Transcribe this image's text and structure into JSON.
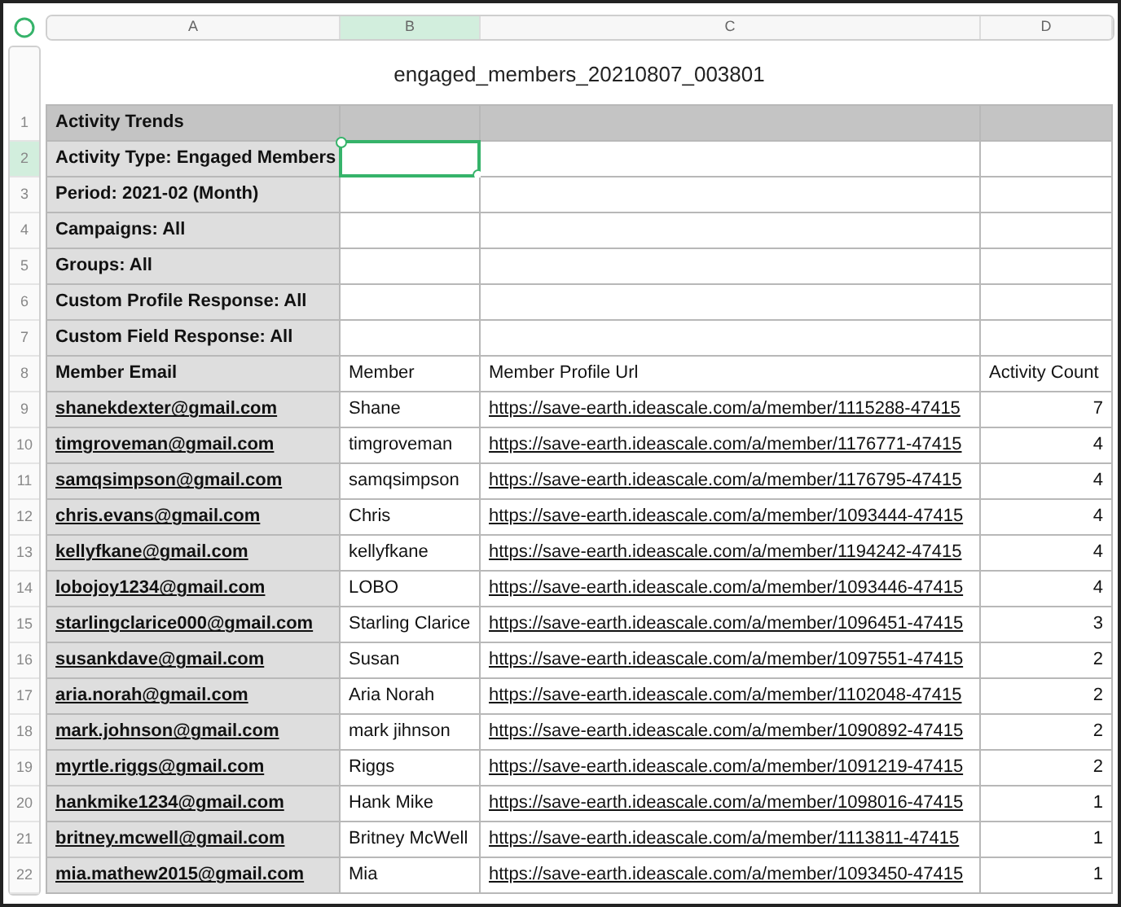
{
  "columns": [
    {
      "label": "A",
      "selected": false
    },
    {
      "label": "B",
      "selected": true
    },
    {
      "label": "C",
      "selected": false
    },
    {
      "label": "D",
      "selected": false
    }
  ],
  "title": "engaged_members_20210807_003801",
  "rows": [
    {
      "number": "1",
      "selected": false,
      "kind": "section",
      "cells": [
        "Activity Trends",
        "",
        "",
        ""
      ]
    },
    {
      "number": "2",
      "selected": true,
      "kind": "meta",
      "cells": [
        "Activity Type: Engaged Members",
        "",
        "",
        ""
      ]
    },
    {
      "number": "3",
      "selected": false,
      "kind": "meta",
      "cells": [
        "Period: 2021-02 (Month)",
        "",
        "",
        ""
      ]
    },
    {
      "number": "4",
      "selected": false,
      "kind": "meta",
      "cells": [
        "Campaigns: All",
        "",
        "",
        ""
      ]
    },
    {
      "number": "5",
      "selected": false,
      "kind": "meta",
      "cells": [
        "Groups: All",
        "",
        "",
        ""
      ]
    },
    {
      "number": "6",
      "selected": false,
      "kind": "meta",
      "cells": [
        "Custom Profile Response: All",
        "",
        "",
        ""
      ]
    },
    {
      "number": "7",
      "selected": false,
      "kind": "meta",
      "cells": [
        "Custom Field Response: All",
        "",
        "",
        ""
      ]
    },
    {
      "number": "8",
      "selected": false,
      "kind": "header",
      "cells": [
        "Member Email",
        "Member",
        "Member Profile Url",
        "Activity Count"
      ]
    },
    {
      "number": "9",
      "selected": false,
      "kind": "data",
      "cells": [
        "shanekdexter@gmail.com",
        "Shane",
        "https://save-earth.ideascale.com/a/member/1115288-47415",
        "7"
      ]
    },
    {
      "number": "10",
      "selected": false,
      "kind": "data",
      "cells": [
        "timgroveman@gmail.com",
        "timgroveman",
        "https://save-earth.ideascale.com/a/member/1176771-47415",
        "4"
      ]
    },
    {
      "number": "11",
      "selected": false,
      "kind": "data",
      "cells": [
        "samqsimpson@gmail.com",
        "samqsimpson",
        "https://save-earth.ideascale.com/a/member/1176795-47415",
        "4"
      ]
    },
    {
      "number": "12",
      "selected": false,
      "kind": "data",
      "cells": [
        "chris.evans@gmail.com",
        "Chris",
        "https://save-earth.ideascale.com/a/member/1093444-47415",
        "4"
      ]
    },
    {
      "number": "13",
      "selected": false,
      "kind": "data",
      "cells": [
        "kellyfkane@gmail.com",
        "kellyfkane",
        "https://save-earth.ideascale.com/a/member/1194242-47415",
        "4"
      ]
    },
    {
      "number": "14",
      "selected": false,
      "kind": "data",
      "cells": [
        "lobojoy1234@gmail.com",
        "LOBO",
        "https://save-earth.ideascale.com/a/member/1093446-47415",
        "4"
      ]
    },
    {
      "number": "15",
      "selected": false,
      "kind": "data",
      "cells": [
        "starlingclarice000@gmail.com",
        "Starling Clarice",
        "https://save-earth.ideascale.com/a/member/1096451-47415",
        "3"
      ]
    },
    {
      "number": "16",
      "selected": false,
      "kind": "data",
      "cells": [
        "susankdave@gmail.com",
        "Susan",
        "https://save-earth.ideascale.com/a/member/1097551-47415",
        "2"
      ]
    },
    {
      "number": "17",
      "selected": false,
      "kind": "data",
      "cells": [
        "aria.norah@gmail.com",
        "Aria Norah",
        "https://save-earth.ideascale.com/a/member/1102048-47415",
        "2"
      ]
    },
    {
      "number": "18",
      "selected": false,
      "kind": "data",
      "cells": [
        "mark.johnson@gmail.com",
        "mark jihnson",
        "https://save-earth.ideascale.com/a/member/1090892-47415",
        "2"
      ]
    },
    {
      "number": "19",
      "selected": false,
      "kind": "data",
      "cells": [
        "myrtle.riggs@gmail.com",
        "Riggs",
        "https://save-earth.ideascale.com/a/member/1091219-47415",
        "2"
      ]
    },
    {
      "number": "20",
      "selected": false,
      "kind": "data",
      "cells": [
        "hankmike1234@gmail.com",
        "Hank Mike",
        "https://save-earth.ideascale.com/a/member/1098016-47415",
        "1"
      ]
    },
    {
      "number": "21",
      "selected": false,
      "kind": "data",
      "cells": [
        "britney.mcwell@gmail.com",
        "Britney McWell",
        "https://save-earth.ideascale.com/a/member/1113811-47415",
        "1"
      ]
    },
    {
      "number": "22",
      "selected": false,
      "kind": "data",
      "cells": [
        "mia.mathew2015@gmail.com",
        "Mia",
        "https://save-earth.ideascale.com/a/member/1093450-47415",
        "1"
      ]
    }
  ]
}
